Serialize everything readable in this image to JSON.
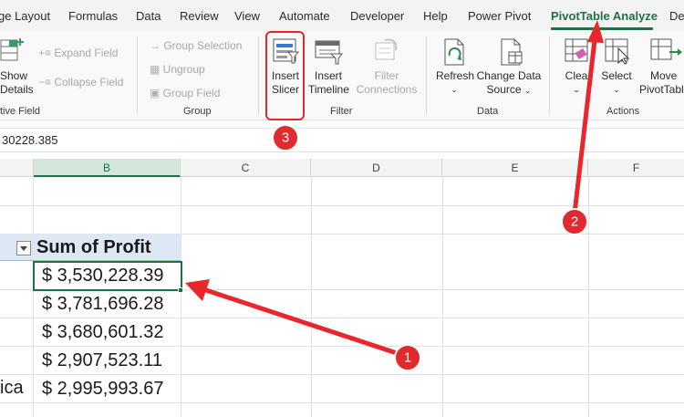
{
  "tabs": [
    "ge Layout",
    "Formulas",
    "Data",
    "Review",
    "View",
    "Automate",
    "Developer",
    "Help",
    "Power Pivot",
    "PivotTable Analyze",
    "De"
  ],
  "active_tab": "PivotTable Analyze",
  "ribbon": {
    "active_field": {
      "show_details_line1": "Show",
      "show_details_line2": "Details",
      "expand_field": "Expand Field",
      "collapse_field": "Collapse Field",
      "label": "tive Field"
    },
    "group": {
      "group_selection": "Group Selection",
      "ungroup": "Ungroup",
      "group_field": "Group Field",
      "label": "Group"
    },
    "filter": {
      "insert_slicer_line1": "Insert",
      "insert_slicer_line2": "Slicer",
      "insert_timeline_line1": "Insert",
      "insert_timeline_line2": "Timeline",
      "filter_connections_line1": "Filter",
      "filter_connections_line2": "Connections",
      "label": "Filter"
    },
    "data": {
      "refresh": "Refresh",
      "change_data_source_line1": "Change Data",
      "change_data_source_line2": "Source",
      "label": "Data"
    },
    "actions": {
      "clear": "Clea",
      "select": "Select",
      "move_line1": "Move",
      "move_line2": "PivotTabl",
      "label": "Actions"
    }
  },
  "formula_bar": {
    "value": "30228.385"
  },
  "columns": [
    "B",
    "C",
    "D",
    "E",
    "F"
  ],
  "selected_column": "B",
  "pivot": {
    "header": "Sum of Profit",
    "values": [
      "$ 3,530,228.39",
      "$ 3,781,696.28",
      "$ 3,680,601.32",
      "$ 2,907,523.11",
      "$ 2,995,993.67"
    ],
    "partial_row_label": "ica"
  },
  "annotations": {
    "badges": [
      "1",
      "2",
      "3"
    ]
  },
  "colors": {
    "accent": "#1e7145",
    "callout": "#e8262b",
    "pivot_header_bg": "#dde8f4"
  }
}
